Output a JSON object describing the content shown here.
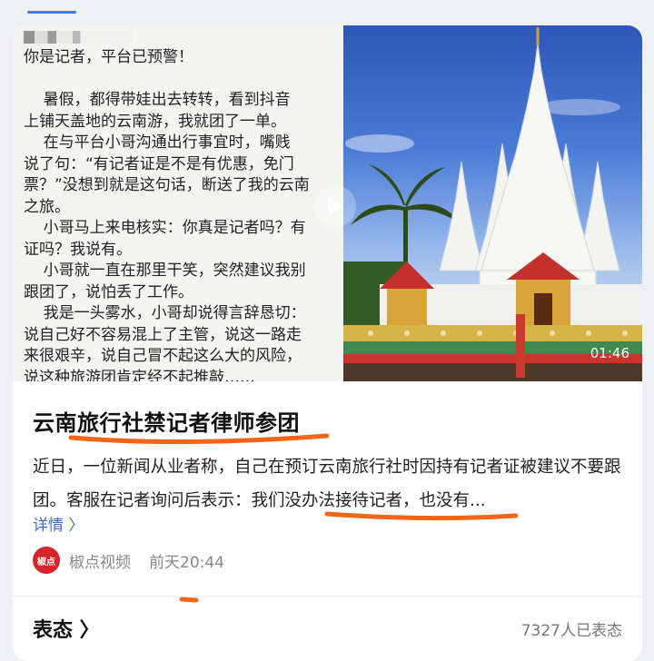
{
  "video": {
    "doc_lines": [
      "你是记者，平台已预警！",
      "",
      "    暑假，都得带娃出去转转，看到抖音",
      "上铺天盖地的云南游，我就团了一单。",
      "    在与平台小哥沟通出行事宜时，嘴贱",
      "说了句：“有记者证是不是有优惠，免门",
      "票？”没想到就是这句话，断送了我的云南",
      "之旅。",
      "    小哥马上来电核实：你真是记者吗？有",
      "证吗？我说有。",
      "    小哥就一直在那里干笑，突然建议我别",
      "跟团了，说怕丢了工作。",
      "    我是一头雾水，小哥却说得言辞恳切：",
      "说自己好不容易混上了主管，说这一路走",
      "来很艰辛，说自己冒不起这么大的风险，",
      "说这种旅游团肯定经不起推敲……"
    ],
    "duration": "01:46"
  },
  "article": {
    "title": "云南旅行社禁记者律师参团",
    "desc": "近日，一位新闻从业者称，自己在预订云南旅行社时因持有记者证被建议不要跟团。客服在记者询问后表示：我们没办法接待记者，也没有...",
    "more": "详情 〉"
  },
  "source": {
    "logo": "椒点",
    "name": "椒点视频",
    "time": "前天20:44"
  },
  "reaction": {
    "label": "表态 〉",
    "count": "7327人已表态"
  },
  "colors": {
    "accent": "#3d7bf6",
    "annotation": "#f0651a",
    "brand": "#d8232a"
  }
}
